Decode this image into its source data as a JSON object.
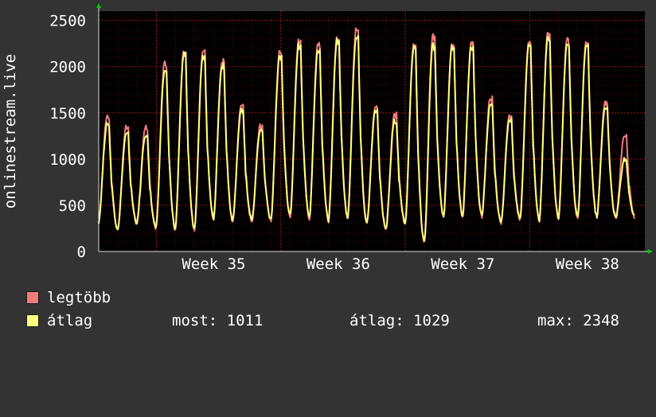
{
  "chart_data": {
    "type": "line",
    "ylabel": "onlinestream.live",
    "ylim": [
      0,
      2600
    ],
    "y_ticks": [
      0,
      500,
      1000,
      1500,
      2000,
      2500
    ],
    "x_tick_labels": [
      "Week 35",
      "Week 36",
      "Week 37",
      "Week 38"
    ],
    "x_unit": "days",
    "x_range": [
      0,
      28.5
    ],
    "week_label_positions": [
      6.0,
      12.5,
      19.0,
      25.5
    ],
    "grid": true,
    "background": "#000000",
    "grid_color": "#a01010",
    "series": [
      {
        "name": "legtöbb",
        "color": "#f47c7c",
        "daily_peaks": [
          1480,
          1360,
          1350,
          2060,
          2180,
          2180,
          2070,
          1600,
          1380,
          2180,
          2320,
          2250,
          2360,
          2430,
          1580,
          1500,
          2250,
          2350,
          2280,
          2280,
          1680,
          1500,
          2280,
          2380,
          2300,
          2300,
          1640,
          1270
        ],
        "daily_troughs": [
          300,
          240,
          300,
          250,
          240,
          240,
          350,
          330,
          330,
          340,
          380,
          360,
          330,
          360,
          300,
          250,
          300,
          100,
          370,
          380,
          380,
          310,
          350,
          330,
          350,
          360,
          370,
          360
        ]
      },
      {
        "name": "átlag",
        "color": "#ffff80",
        "daily_peaks": [
          1390,
          1280,
          1260,
          1970,
          2140,
          2150,
          2030,
          1540,
          1330,
          2120,
          2260,
          2200,
          2310,
          2340,
          1530,
          1430,
          2220,
          2250,
          2250,
          2250,
          1610,
          1440,
          2240,
          2330,
          2270,
          2250,
          1580,
          1011
        ],
        "daily_troughs": [
          320,
          250,
          310,
          260,
          250,
          250,
          360,
          340,
          340,
          350,
          390,
          370,
          340,
          370,
          310,
          260,
          310,
          100,
          380,
          390,
          390,
          320,
          360,
          340,
          360,
          370,
          380,
          370
        ]
      }
    ]
  },
  "legend": {
    "items": [
      {
        "label": "legtöbb",
        "color": "#f47c7c"
      },
      {
        "label": "átlag",
        "color": "#ffff80"
      }
    ],
    "stats": {
      "now_label": "most: 1011",
      "avg_label": "átlag: 1029",
      "max_label": "max: 2348"
    }
  }
}
